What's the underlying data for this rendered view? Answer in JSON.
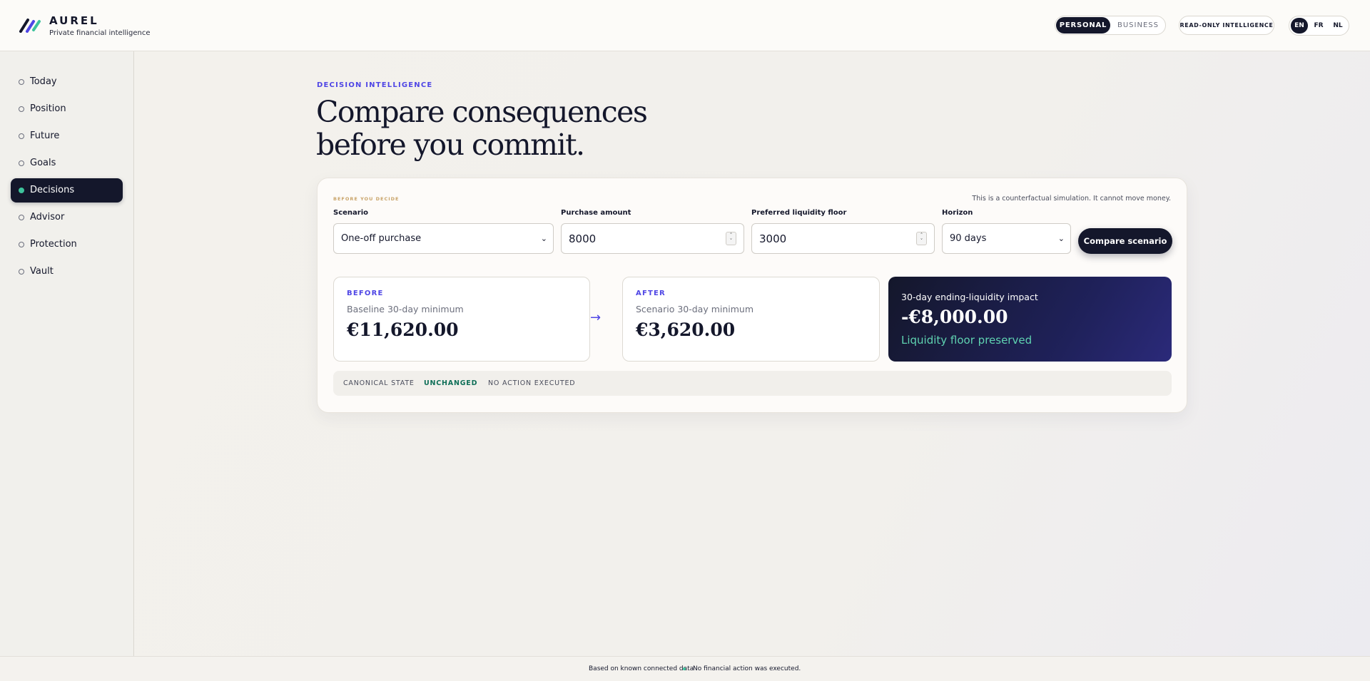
{
  "header": {
    "brand_name": "AUREL",
    "brand_tagline": "Private financial intelligence",
    "mode_personal": "PERSONAL",
    "mode_business": "BUSINESS",
    "readonly_label": "READ-ONLY INTELLIGENCE",
    "languages": [
      "EN",
      "FR",
      "NL"
    ],
    "active_language": "EN"
  },
  "sidebar": {
    "items": [
      {
        "label": "Today"
      },
      {
        "label": "Position"
      },
      {
        "label": "Future"
      },
      {
        "label": "Goals"
      },
      {
        "label": "Decisions",
        "active": true
      },
      {
        "label": "Advisor"
      },
      {
        "label": "Protection"
      },
      {
        "label": "Vault"
      }
    ]
  },
  "main": {
    "eyebrow": "DECISION INTELLIGENCE",
    "headline_line1": "Compare consequences",
    "headline_line2": "before you commit.",
    "card": {
      "eyebrow": "BEFORE YOU DECIDE",
      "disclaimer": "This is a counterfactual simulation. It cannot move money.",
      "scenario_label": "Scenario",
      "scenario_value": "One-off purchase",
      "amount_label": "Purchase amount",
      "amount_value": "8000",
      "floor_label": "Preferred liquidity floor",
      "floor_value": "3000",
      "horizon_label": "Horizon",
      "horizon_value": "90 days",
      "compare_button": "Compare scenario",
      "before": {
        "tag": "BEFORE",
        "subtitle": "Baseline 30-day minimum",
        "value": "€11,620.00"
      },
      "arrow": "→",
      "after": {
        "tag": "AFTER",
        "subtitle": "Scenario 30-day minimum",
        "value": "€3,620.00"
      },
      "impact": {
        "title": "30-day ending-liquidity impact",
        "value": "-€8,000.00",
        "note": "Liquidity floor preserved"
      },
      "state": {
        "label": "CANONICAL STATE",
        "status": "UNCHANGED",
        "action": "NO ACTION EXECUTED"
      }
    }
  },
  "footer": {
    "left": "Based on known connected data",
    "right": "No financial action was executed."
  },
  "colors": {
    "navy": "#14172b",
    "accent": "#4f46e5",
    "green": "#3ec39c",
    "gold": "#c9a46a"
  }
}
